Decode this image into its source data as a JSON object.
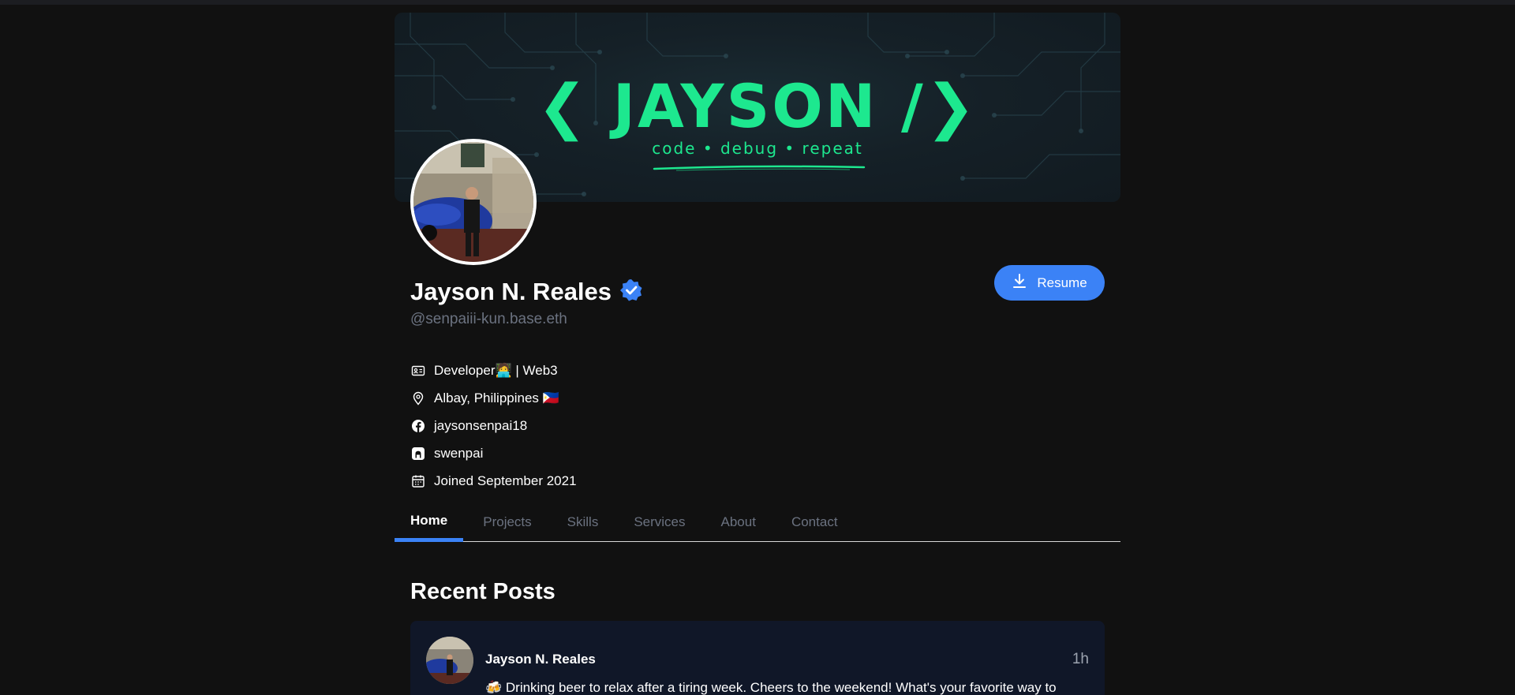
{
  "banner": {
    "logo_text": "❮ JAYSON /❯",
    "tagline": "code • debug • repeat"
  },
  "profile": {
    "name": "Jayson N. Reales",
    "handle": "@senpaiii-kun.base.eth",
    "resume_label": "Resume",
    "info": [
      {
        "icon": "id-card-icon",
        "text": "Developer🧑‍💻 | Web3"
      },
      {
        "icon": "location-pin-icon",
        "text": "Albay, Philippines 🇵🇭"
      },
      {
        "icon": "facebook-icon",
        "text": "jaysonsenpai18"
      },
      {
        "icon": "github-icon",
        "text": "swenpai"
      },
      {
        "icon": "calendar-icon",
        "text": "Joined September 2021"
      }
    ]
  },
  "tabs": [
    {
      "label": "Home",
      "active": true
    },
    {
      "label": "Projects",
      "active": false
    },
    {
      "label": "Skills",
      "active": false
    },
    {
      "label": "Services",
      "active": false
    },
    {
      "label": "About",
      "active": false
    },
    {
      "label": "Contact",
      "active": false
    }
  ],
  "recent_posts": {
    "title": "Recent Posts",
    "posts": [
      {
        "author": "Jayson N. Reales",
        "time": "1h",
        "text": "🍻 Drinking beer to relax after a tiring week. Cheers to the weekend! What's your favorite way to unwind? #WeekendVibes #Relaxation"
      }
    ]
  },
  "colors": {
    "accent": "#3b82f6",
    "brand_green": "#1de88f",
    "background": "#111111",
    "card": "#101728"
  }
}
